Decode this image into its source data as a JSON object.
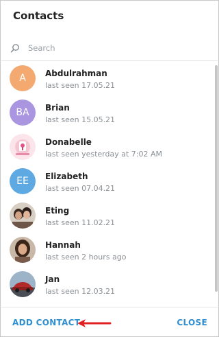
{
  "dialog": {
    "title": "Contacts"
  },
  "search": {
    "placeholder": "Search",
    "value": "",
    "icon": "search-icon"
  },
  "contacts": [
    {
      "name": "Abdulrahman",
      "status": "last seen 17.05.21",
      "initials": "A",
      "avatar_color": "#f4a971"
    },
    {
      "name": "Brian",
      "status": "last seen 15.05.21",
      "initials": "BA",
      "avatar_color": "#a995e0"
    },
    {
      "name": "Donabelle",
      "status": "last seen yesterday at 7:02 AM",
      "initials": "",
      "avatar_color": "#f3c6d2"
    },
    {
      "name": "Elizabeth",
      "status": "last seen 07.04.21",
      "initials": "EE",
      "avatar_color": "#5fa9e3"
    },
    {
      "name": "Eting",
      "status": "last seen 11.02.21",
      "initials": "",
      "avatar_color": "#6d5547"
    },
    {
      "name": "Hannah",
      "status": "last seen 2 hours ago",
      "initials": "",
      "avatar_color": "#7a5a4a"
    },
    {
      "name": "Jan",
      "status": "last seen 12.03.21",
      "initials": "",
      "avatar_color": "#b32a2a"
    }
  ],
  "footer": {
    "add_contact_label": "ADD CONTACT",
    "close_label": "CLOSE"
  },
  "colors": {
    "accent": "#2f8fd1",
    "annotation_arrow": "#e02020"
  }
}
